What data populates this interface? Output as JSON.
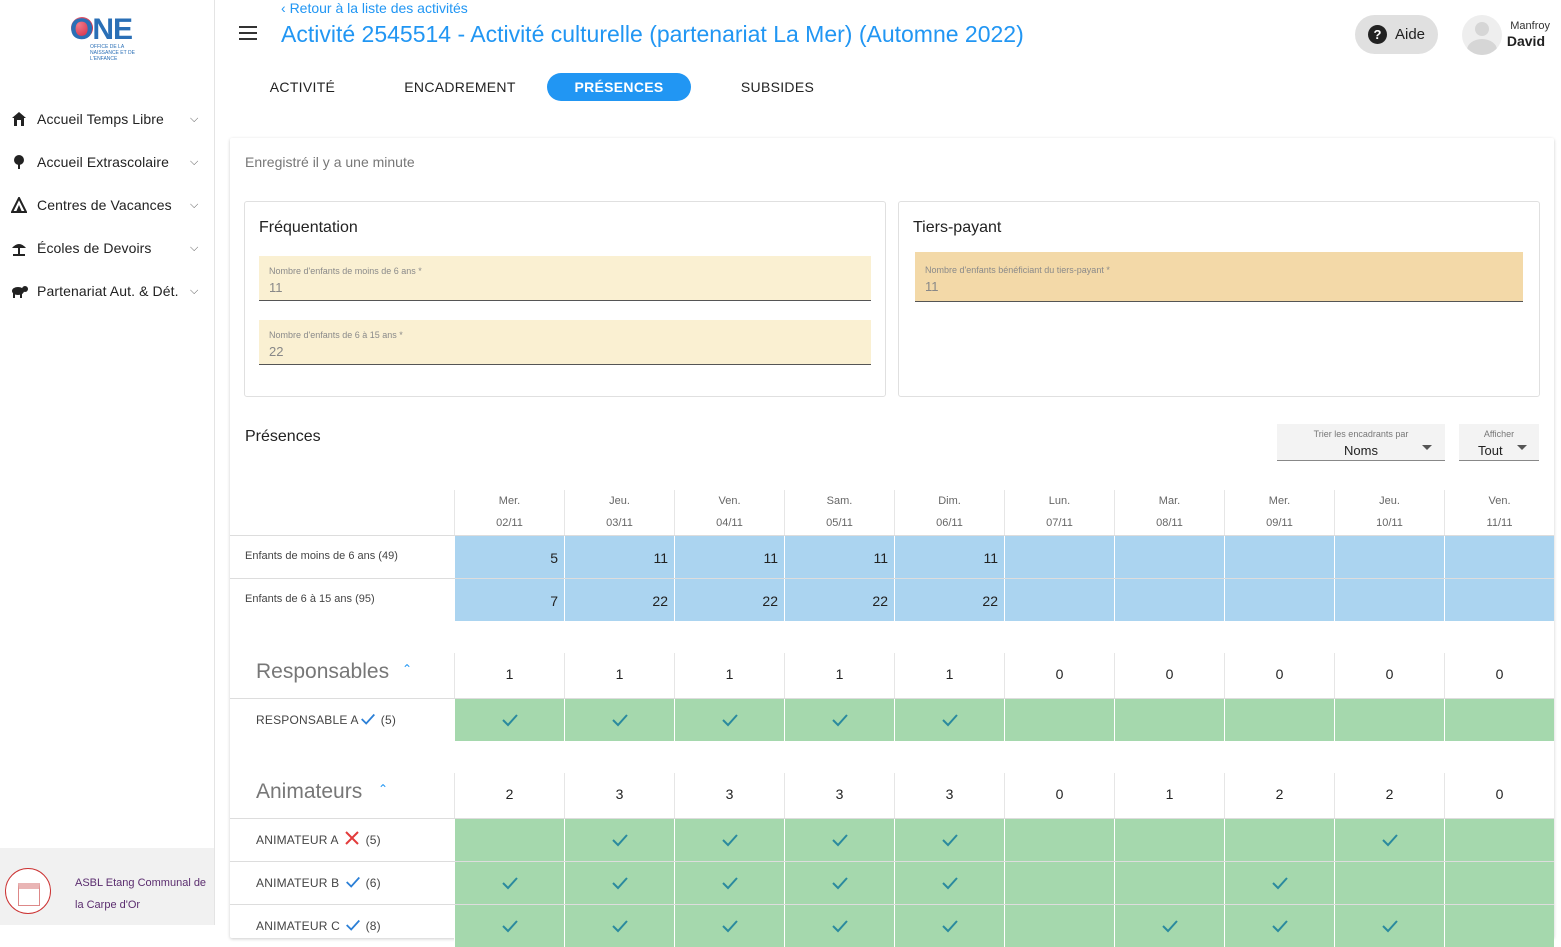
{
  "sidebar": {
    "logo": {
      "text": "ONE",
      "subtitle": "OFFICE DE LA NAISSANCE ET DE L'ENFANCE"
    },
    "items": [
      {
        "label": "Accueil Temps Libre",
        "icon": "house-icon"
      },
      {
        "label": "Accueil Extrascolaire",
        "icon": "tree-icon"
      },
      {
        "label": "Centres de Vacances",
        "icon": "tent-icon"
      },
      {
        "label": "Écoles de Devoirs",
        "icon": "umbrella-icon"
      },
      {
        "label": "Partenariat Aut. & Dét.",
        "icon": "animal-icon"
      }
    ],
    "organization": "ASBL Etang Communal de la Carpe d'Or"
  },
  "header": {
    "back_link": "Retour à la liste des activités",
    "title": "Activité 2545514 - Activité culturelle (partenariat La Mer) (Automne 2022)",
    "help_label": "Aide",
    "user_lastname": "Manfroy",
    "user_firstname": "David"
  },
  "tabs": [
    {
      "label": "ACTIVITÉ",
      "active": false
    },
    {
      "label": "ENCADREMENT",
      "active": false
    },
    {
      "label": "PRÉSENCES",
      "active": true
    },
    {
      "label": "SUBSIDES",
      "active": false
    }
  ],
  "saved_status": "Enregistré il y a une minute",
  "frequentation": {
    "title": "Fréquentation",
    "under6_label": "Nombre d'enfants de moins de 6 ans *",
    "under6_value": "11",
    "age6to15_label": "Nombre d'enfants de 6 à 15 ans *",
    "age6to15_value": "22"
  },
  "tiers_payant": {
    "title": "Tiers-payant",
    "label": "Nombre d'enfants bénéficiant du tiers-payant *",
    "value": "11"
  },
  "presences": {
    "title": "Présences",
    "sort_label": "Trier les encadrants par",
    "sort_value": "Noms",
    "show_label": "Afficher",
    "show_value": "Tout",
    "days": [
      {
        "name": "Mer.",
        "date": "02/11"
      },
      {
        "name": "Jeu.",
        "date": "03/11"
      },
      {
        "name": "Ven.",
        "date": "04/11"
      },
      {
        "name": "Sam.",
        "date": "05/11"
      },
      {
        "name": "Dim.",
        "date": "06/11"
      },
      {
        "name": "Lun.",
        "date": "07/11"
      },
      {
        "name": "Mar.",
        "date": "08/11"
      },
      {
        "name": "Mer.",
        "date": "09/11"
      },
      {
        "name": "Jeu.",
        "date": "10/11"
      },
      {
        "name": "Ven.",
        "date": "11/11"
      }
    ],
    "child_rows": [
      {
        "label": "Enfants de moins de 6 ans (49)",
        "values": [
          "5",
          "11",
          "11",
          "11",
          "11",
          "",
          "",
          "",
          "",
          ""
        ]
      },
      {
        "label": "Enfants de 6 à 15 ans (95)",
        "values": [
          "7",
          "22",
          "22",
          "22",
          "22",
          "",
          "",
          "",
          "",
          ""
        ]
      }
    ],
    "groups": [
      {
        "title": "Responsables",
        "counts": [
          "1",
          "1",
          "1",
          "1",
          "1",
          "0",
          "0",
          "0",
          "0",
          "0"
        ],
        "people": [
          {
            "name": "RESPONSABLE A",
            "status": "check",
            "count": "(5)",
            "presence": [
              true,
              true,
              true,
              true,
              true,
              false,
              false,
              false,
              false,
              false
            ]
          }
        ]
      },
      {
        "title": "Animateurs",
        "counts": [
          "2",
          "3",
          "3",
          "3",
          "3",
          "0",
          "1",
          "2",
          "2",
          "0"
        ],
        "people": [
          {
            "name": "ANIMATEUR A",
            "status": "cross",
            "count": "(5)",
            "presence": [
              false,
              true,
              true,
              true,
              true,
              false,
              false,
              false,
              true,
              false
            ]
          },
          {
            "name": "ANIMATEUR B",
            "status": "check",
            "count": "(6)",
            "presence": [
              true,
              true,
              true,
              true,
              true,
              false,
              false,
              true,
              false,
              false
            ]
          },
          {
            "name": "ANIMATEUR C",
            "status": "check",
            "count": "(8)",
            "presence": [
              true,
              true,
              true,
              true,
              true,
              false,
              true,
              true,
              true,
              false
            ]
          }
        ]
      }
    ]
  },
  "colors": {
    "accent": "#2196f3",
    "presence_green": "#a5d8ad",
    "child_blue": "#abd4f0",
    "field_yellow": "#faf0d2",
    "field_orange": "#f3d9a8"
  }
}
